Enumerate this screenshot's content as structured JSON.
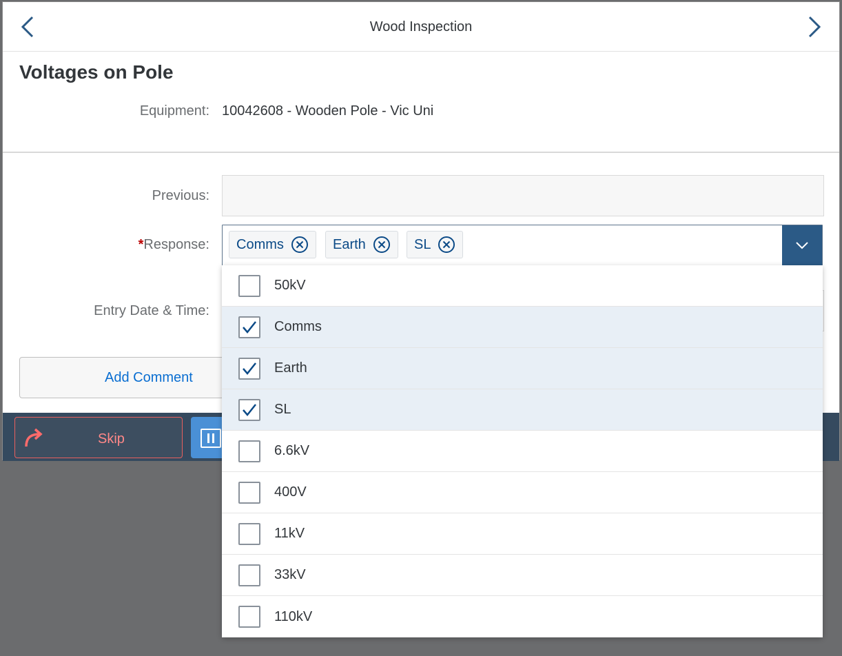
{
  "header": {
    "title": "Wood Inspection"
  },
  "section": {
    "title": "Voltages on Pole"
  },
  "equipment": {
    "label": "Equipment:",
    "value": "10042608 - Wooden Pole - Vic Uni"
  },
  "previous": {
    "label": "Previous:",
    "value": ""
  },
  "response": {
    "required_marker": "*",
    "label": "Response:",
    "tokens": [
      "Comms",
      "Earth",
      "SL"
    ]
  },
  "entry": {
    "label": "Entry Date & Time:"
  },
  "add_comment": {
    "label": "Add Comment"
  },
  "footer": {
    "skip_label": "Skip"
  },
  "options": [
    {
      "label": "50kV",
      "checked": false
    },
    {
      "label": "Comms",
      "checked": true
    },
    {
      "label": "Earth",
      "checked": true
    },
    {
      "label": "SL",
      "checked": true
    },
    {
      "label": "6.6kV",
      "checked": false
    },
    {
      "label": "400V",
      "checked": false
    },
    {
      "label": "11kV",
      "checked": false
    },
    {
      "label": "33kV",
      "checked": false
    },
    {
      "label": "110kV",
      "checked": false
    }
  ],
  "colors": {
    "accent": "#2b5a86",
    "footer": "#354a5f",
    "required": "#bb0000",
    "selected_row": "#e8eff6"
  }
}
